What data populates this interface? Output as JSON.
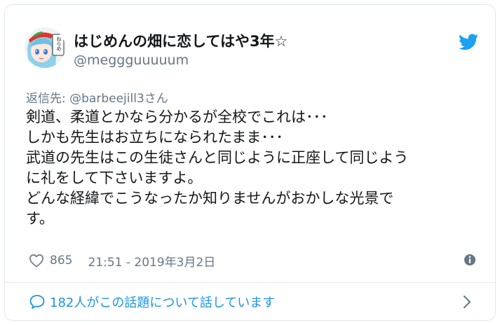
{
  "user": {
    "display_name": "はじめんの畑に恋してはや3年☆",
    "handle": "@meggguuuuum",
    "avatar_badge_text": "ねらめ"
  },
  "reply": {
    "prefix": "返信先: ",
    "target": "@barbeejill3さん"
  },
  "tweet": {
    "lines": [
      "剣道、柔道とかなら分かるが全校でこれは･･･",
      "しかも先生はお立ちになられたまま･･･",
      "武道の先生はこの生徒さんと同じように正座して同じよう",
      "に礼をして下さいますよ。",
      "どんな経緯でこうなったか知りませんがおかしな光景で",
      "す。"
    ]
  },
  "meta": {
    "like_count": "865",
    "timestamp": "21:51 - 2019年3月2日"
  },
  "conversation": {
    "text": "182人がこの話題について話しています"
  },
  "icons": {
    "twitter_logo": "twitter-bird-icon",
    "like": "heart-icon",
    "info": "info-icon",
    "conversation": "speech-bubble-icon",
    "chevron": "chevron-right-icon"
  },
  "colors": {
    "link_blue": "#1b95e0",
    "twitter_blue": "#1da1f2",
    "secondary_text": "#657786",
    "primary_text": "#14171a",
    "border": "#e1e8ed"
  }
}
